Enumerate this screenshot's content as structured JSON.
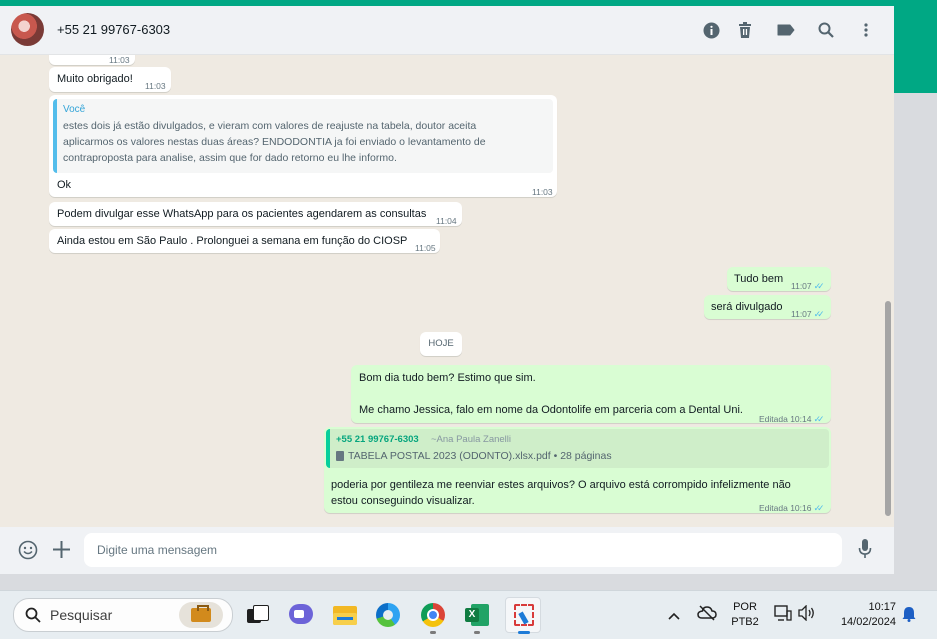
{
  "window": {
    "accent": "#00a884"
  },
  "header": {
    "contact": "+55 21 99767-6303",
    "icons": [
      "info-icon",
      "trash-icon",
      "label-icon",
      "search-icon",
      "more-vertical-icon"
    ]
  },
  "messages": {
    "m0": {
      "time": "11:03"
    },
    "m1": {
      "text": "Muito obrigado!",
      "time": "11:03"
    },
    "m2": {
      "quote_author": "Você",
      "quote_lines": [
        "estes dois já estão divulgados, e vieram com valores de reajuste na tabela, doutor aceita",
        "aplicarmos os valores nestas duas áreas? ENDODONTIA ja foi enviado o levantamento de",
        "contraproposta para analise, assim que for dado retorno eu lhe informo."
      ],
      "text": "Ok",
      "time": "11:03"
    },
    "m3": {
      "text": "Podem divulgar esse WhatsApp para os pacientes agendarem as consultas",
      "time": "11:04"
    },
    "m4": {
      "text": "Ainda estou em São Paulo . Prolonguei a semana em função do CIOSP",
      "time": "11:05"
    },
    "m5": {
      "text": "Tudo bem",
      "time": "11:07"
    },
    "m6": {
      "text": "será divulgado",
      "time": "11:07"
    },
    "date_divider": "HOJE",
    "m7": {
      "line1": "Bom dia tudo bem? Estimo que sim.",
      "line2": "Me chamo Jessica, falo em nome da Odontolife em parceria com a Dental Uni.",
      "time": "Editada 10:14"
    },
    "m8": {
      "quote_author": "+55 21 99767-6303",
      "quote_name": "~Ana Paula Zanelli",
      "quote_file": "TABELA POSTAL 2023 (ODONTO).xlsx.pdf • 28 páginas",
      "line1": "poderia por gentileza me reenviar estes arquivos? O arquivo está corrompido infelizmente não",
      "line2": "estou conseguindo visualizar.",
      "time": "Editada 10:16"
    }
  },
  "composer": {
    "placeholder": "Digite uma mensagem"
  },
  "taskbar": {
    "search_label": "Pesquisar",
    "lang_top": "POR",
    "lang_bottom": "PTB2",
    "clock_time": "10:17",
    "clock_date": "14/02/2024"
  }
}
